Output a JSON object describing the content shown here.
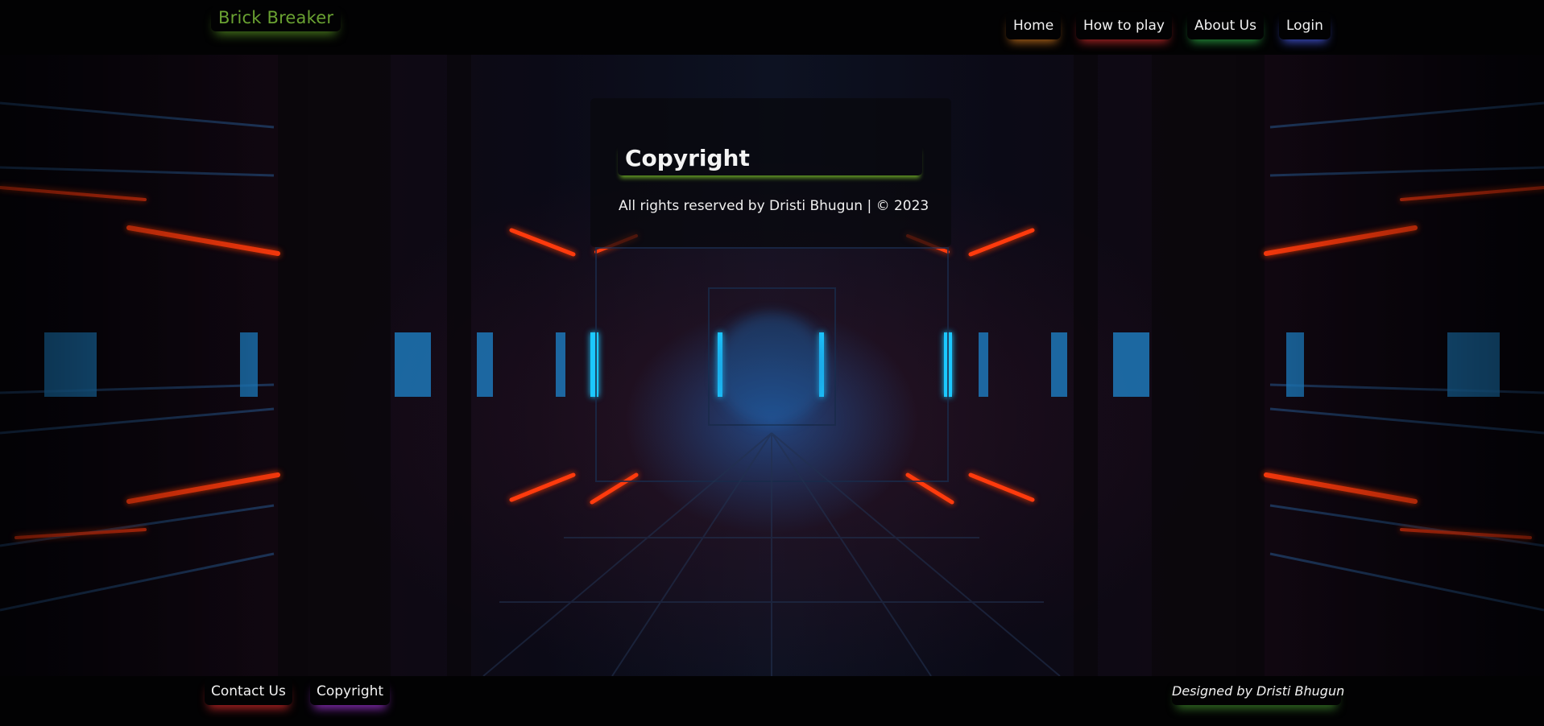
{
  "header": {
    "logo": "Brick Breaker",
    "nav": [
      {
        "label": "Home"
      },
      {
        "label": "How to play"
      },
      {
        "label": "About Us"
      },
      {
        "label": "Login"
      }
    ]
  },
  "main": {
    "title": "Copyright",
    "text": "All rights reserved by Dristi Bhugun | © 2023"
  },
  "footer": {
    "links": [
      {
        "label": "Contact Us"
      },
      {
        "label": "Copyright"
      }
    ],
    "credit": "Designed by Dristi Bhugun"
  },
  "colors": {
    "logo": "#6aa232",
    "home_glow": "#d2781e",
    "how_to_play_glow": "#d22d2d",
    "about_glow": "#2daf46",
    "login_glow": "#465ae6",
    "contact_glow": "#c82828",
    "copyright_glow": "#9632c8",
    "credit_glow": "#469632",
    "title_glow": "#6eaa28",
    "neon_blue": "#1ec8ff",
    "neon_red": "#ff3a10"
  },
  "icons": {
    "background": "neon-tunnel-background"
  }
}
